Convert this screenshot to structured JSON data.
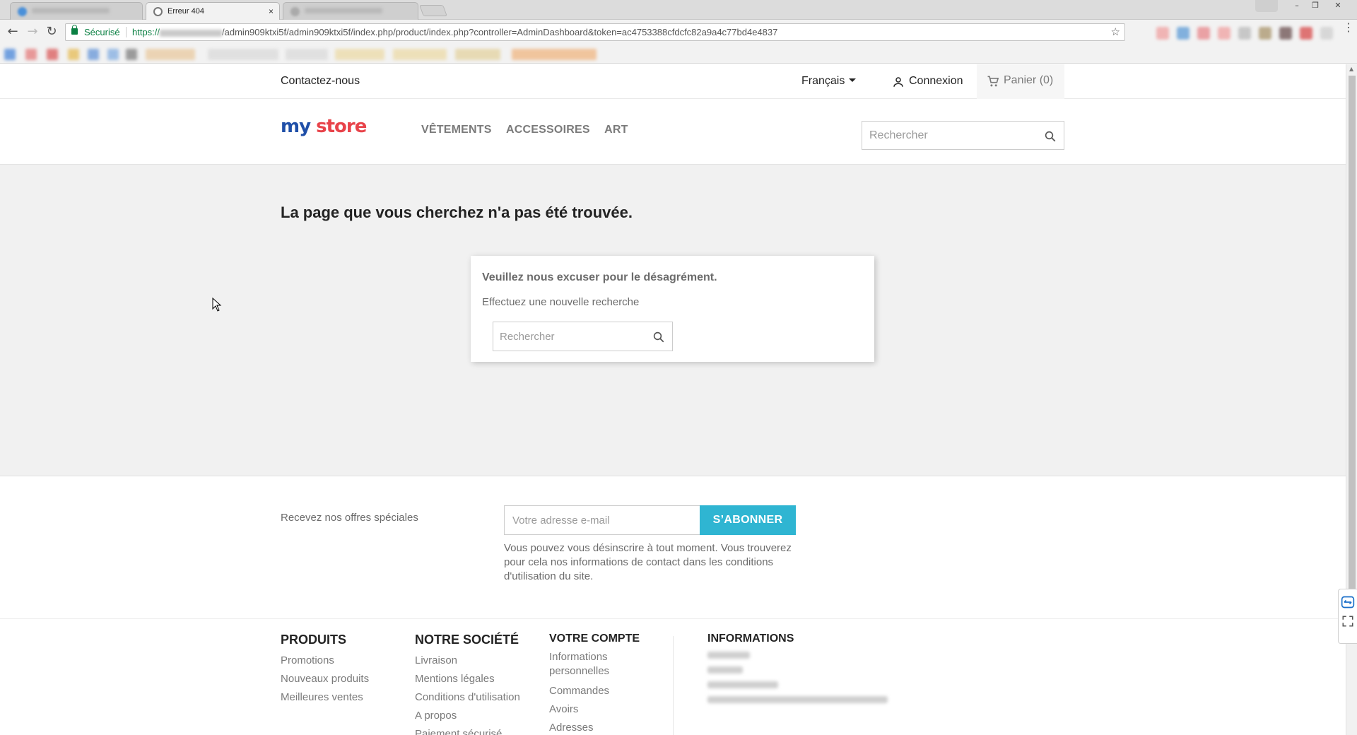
{
  "browser": {
    "tabs": [
      {
        "label": "",
        "active": false
      },
      {
        "label": "Erreur 404",
        "active": true
      },
      {
        "label": "",
        "active": false
      }
    ],
    "url_security_label": "Sécurisé",
    "url_scheme": "https://",
    "url_path": "/admin909ktxi5f/admin909ktxi5f/index.php/product/index.php?controller=AdminDashboard&token=ac4753388cfdcfc82a9a4c77bd4e4837",
    "tab_close_glyph": "×",
    "star_glyph": "☆"
  },
  "topnav": {
    "contact": "Contactez-nous",
    "language": "Français",
    "login": "Connexion",
    "cart": "Panier (0)"
  },
  "header": {
    "logo_part1": "my",
    "logo_part2": "store",
    "menu": [
      "VÊTEMENTS",
      "ACCESSOIRES",
      "ART"
    ],
    "search_placeholder": "Rechercher"
  },
  "content": {
    "title": "La page que vous cherchez n'a pas été trouvée.",
    "sorry": "Veuillez nous excuser pour le désagrément.",
    "search_again": "Effectuez une nouvelle recherche",
    "search_placeholder": "Rechercher"
  },
  "newsletter": {
    "label": "Recevez nos offres spéciales",
    "email_placeholder": "Votre adresse e-mail",
    "subscribe": "S’ABONNER",
    "note": "Vous pouvez vous désinscrire à tout moment. Vous trouverez pour cela nos informations de contact dans les conditions d'utilisation du site."
  },
  "footer": {
    "produits": {
      "title": "PRODUITS",
      "links": [
        "Promotions",
        "Nouveaux produits",
        "Meilleures ventes"
      ]
    },
    "societe": {
      "title": "NOTRE SOCIÉTÉ",
      "links": [
        "Livraison",
        "Mentions légales",
        "Conditions d'utilisation",
        "A propos",
        "Paiement sécurisé"
      ]
    },
    "compte": {
      "title": "VOTRE COMPTE",
      "links": [
        "Informations personnelles",
        "Commandes",
        "Avoirs",
        "Adresses"
      ]
    },
    "informations": {
      "title": "INFORMATIONS"
    }
  },
  "colors": {
    "accent": "#2fb5d2",
    "secure_green": "#0b8043",
    "content_bg": "#f1f1f1"
  }
}
